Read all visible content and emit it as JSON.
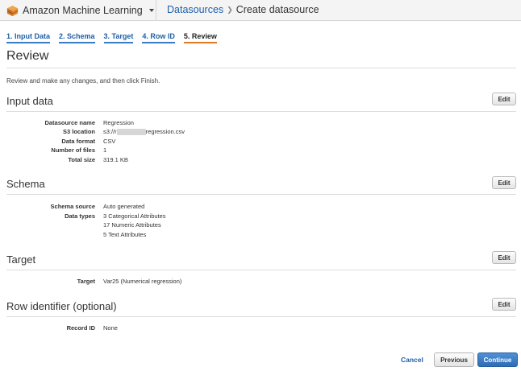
{
  "header": {
    "app_name": "Amazon Machine Learning",
    "app_icon": "cube-icon",
    "breadcrumb_link": "Datasources",
    "breadcrumb_separator": "❯",
    "breadcrumb_current": "Create datasource"
  },
  "steps": [
    {
      "label": "1. Input Data",
      "active": false
    },
    {
      "label": "2. Schema",
      "active": false
    },
    {
      "label": "3. Target",
      "active": false
    },
    {
      "label": "4. Row ID",
      "active": false
    },
    {
      "label": "5. Review",
      "active": true
    }
  ],
  "page": {
    "title": "Review",
    "intro": "Review and make any changes, and then click Finish."
  },
  "sections": {
    "input_data": {
      "title": "Input data",
      "edit_label": "Edit",
      "rows": [
        {
          "key": "Datasource name",
          "value": "Regression"
        },
        {
          "key": "S3 location",
          "value_prefix": "s3://r",
          "value_suffix": "regression.csv"
        },
        {
          "key": "Data format",
          "value": "CSV"
        },
        {
          "key": "Number of files",
          "value": "1"
        },
        {
          "key": "Total size",
          "value": "319.1 KB"
        }
      ]
    },
    "schema": {
      "title": "Schema",
      "edit_label": "Edit",
      "source_key": "Schema source",
      "source_value": "Auto generated",
      "types_key": "Data types",
      "types": [
        "3 Categorical Attributes",
        "17 Numeric Attributes",
        "5 Text Attributes"
      ]
    },
    "target": {
      "title": "Target",
      "edit_label": "Edit",
      "key": "Target",
      "value": "Var25 (Numerical regression)"
    },
    "row_id": {
      "title": "Row identifier (optional)",
      "edit_label": "Edit",
      "key": "Record ID",
      "value": "None"
    }
  },
  "footer": {
    "cancel_label": "Cancel",
    "previous_label": "Previous",
    "continue_label": "Continue"
  },
  "colors": {
    "link": "#1e5fa8",
    "active_step_underline": "#e07b25",
    "primary_button": "#2e6cb5"
  }
}
